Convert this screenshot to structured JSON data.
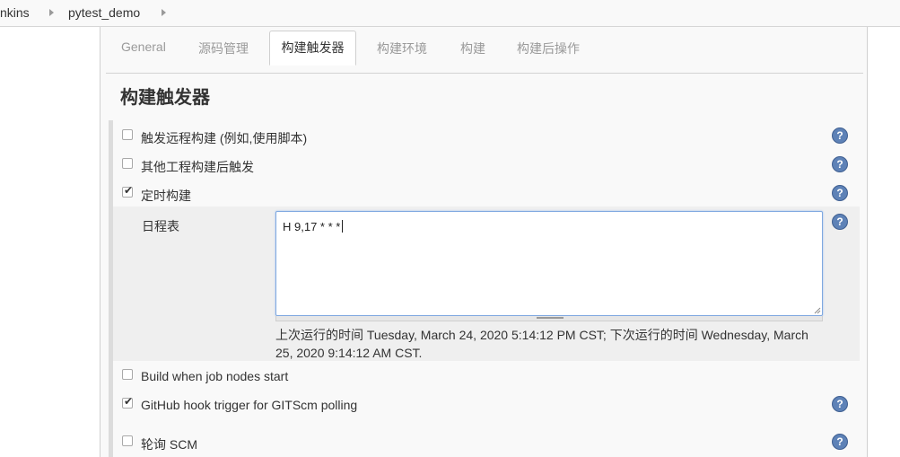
{
  "breadcrumb": {
    "items": [
      "nkins",
      "pytest_demo"
    ]
  },
  "tabs": [
    {
      "label": "General",
      "active": false
    },
    {
      "label": "源码管理",
      "active": false
    },
    {
      "label": "构建触发器",
      "active": true
    },
    {
      "label": "构建环境",
      "active": false
    },
    {
      "label": "构建",
      "active": false
    },
    {
      "label": "构建后操作",
      "active": false
    }
  ],
  "section": {
    "title": "构建触发器"
  },
  "triggers": [
    {
      "label": "触发远程构建 (例如,使用脚本)",
      "checked": false,
      "has_help": true
    },
    {
      "label": "其他工程构建后触发",
      "checked": false,
      "has_help": true
    },
    {
      "label": "定时构建",
      "checked": true,
      "has_help": true
    },
    {
      "label": "Build when job nodes start",
      "checked": false,
      "has_help": false
    },
    {
      "label": "GitHub hook trigger for GITScm polling",
      "checked": true,
      "has_help": true
    },
    {
      "label": "轮询 SCM",
      "checked": false,
      "has_help": true
    }
  ],
  "schedule": {
    "label": "日程表",
    "value": "H 9,17 * * *",
    "run_info": "上次运行的时间 Tuesday, March 24, 2020 5:14:12 PM CST; 下次运行的时间 Wednesday, March 25, 2020 9:14:12 AM CST."
  },
  "icons": {
    "help": "help-icon",
    "checkmark": "✔",
    "help_glyph": "?"
  },
  "colors": {
    "help_blue": "#5e82b7",
    "input_focus": "#7fa8e0",
    "panel_bg": "#f9f9f9"
  }
}
